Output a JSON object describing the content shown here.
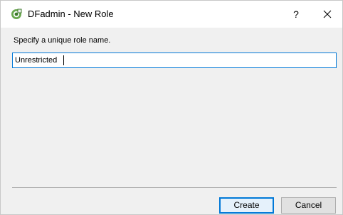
{
  "window": {
    "title": "DFadmin - New Role",
    "help_label": "?"
  },
  "dialog": {
    "prompt": "Specify a unique role name.",
    "role_name_value": "Unrestricted"
  },
  "buttons": {
    "create_label": "Create",
    "cancel_label": "Cancel"
  },
  "colors": {
    "accent": "#0078d7",
    "icon_green": "#6aa84f"
  }
}
